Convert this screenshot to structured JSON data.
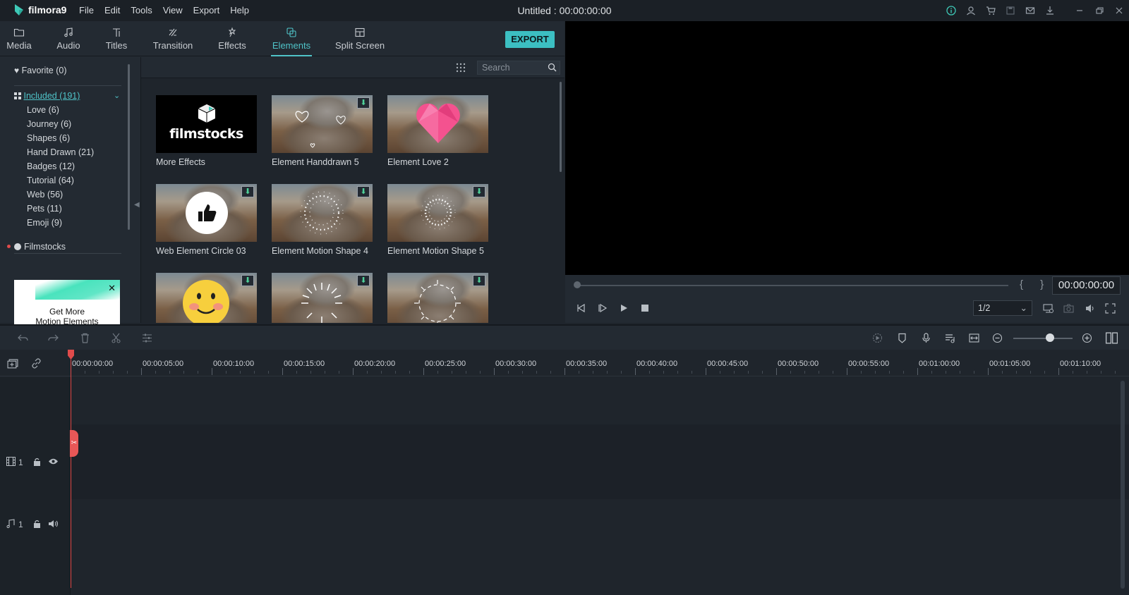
{
  "app": {
    "name": "filmora9",
    "doc_title": "Untitled : 00:00:00:00"
  },
  "menu": [
    "File",
    "Edit",
    "Tools",
    "View",
    "Export",
    "Help"
  ],
  "tabs": [
    {
      "label": "Media",
      "icon": "folder-icon"
    },
    {
      "label": "Audio",
      "icon": "music-note-icon"
    },
    {
      "label": "Titles",
      "icon": "text-icon"
    },
    {
      "label": "Transition",
      "icon": "transition-icon"
    },
    {
      "label": "Effects",
      "icon": "effects-icon"
    },
    {
      "label": "Elements",
      "icon": "elements-icon",
      "active": true
    },
    {
      "label": "Split Screen",
      "icon": "split-screen-icon"
    }
  ],
  "export_label": "EXPORT",
  "sidebar": {
    "favorite": "Favorite (0)",
    "included": "Included (191)",
    "items": [
      "Love (6)",
      "Journey (6)",
      "Shapes (6)",
      "Hand Drawn (21)",
      "Badges (12)",
      "Tutorial (64)",
      "Web (56)",
      "Pets (11)",
      "Emoji (9)"
    ],
    "filmstocks": "Filmstocks",
    "promo": {
      "line1": "Get More",
      "line2": "Motion Elements"
    }
  },
  "search": {
    "placeholder": "Search"
  },
  "elements": [
    {
      "label": "More Effects",
      "logo_text": "filmstocks"
    },
    {
      "label": "Element Handdrawn 5"
    },
    {
      "label": "Element Love 2"
    },
    {
      "label": "Web Element Circle 03"
    },
    {
      "label": "Element Motion Shape 4"
    },
    {
      "label": "Element Motion Shape 5"
    },
    {
      "label": ""
    },
    {
      "label": ""
    },
    {
      "label": ""
    }
  ],
  "preview": {
    "timecode": "00:00:00:00",
    "ratio": "1/2",
    "brackets": "{ }"
  },
  "ruler": [
    "00:00:00:00",
    "00:00:05:00",
    "00:00:10:00",
    "00:00:15:00",
    "00:00:20:00",
    "00:00:25:00",
    "00:00:30:00",
    "00:00:35:00",
    "00:00:40:00",
    "00:00:45:00",
    "00:00:50:00",
    "00:00:55:00",
    "00:01:00:00",
    "00:01:05:00",
    "00:01:10:00"
  ],
  "tracks": {
    "video_num": "1",
    "audio_num": "1"
  },
  "colors": {
    "accent": "#4fc3c8",
    "playhead": "#e04b4b",
    "export_bg": "#3cbfc2"
  }
}
